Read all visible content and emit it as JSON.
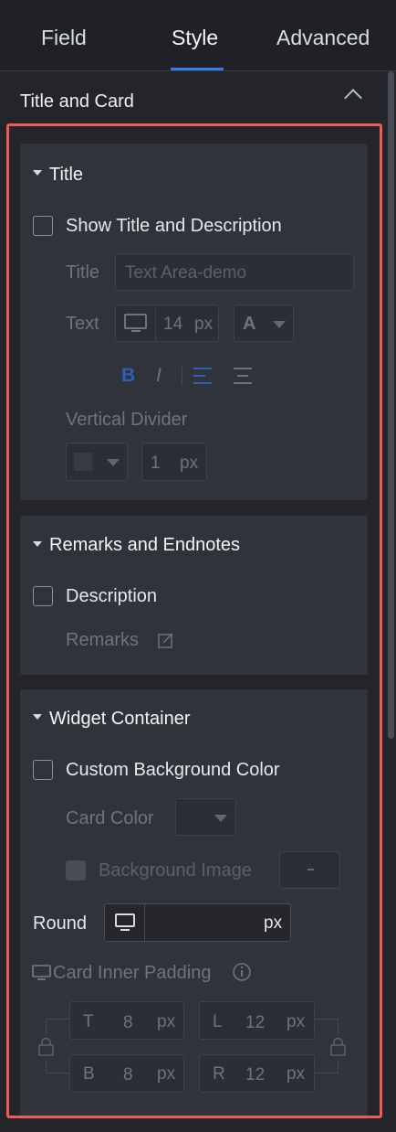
{
  "tabs": [
    {
      "label": "Field"
    },
    {
      "label": "Style"
    },
    {
      "label": "Advanced"
    }
  ],
  "section": {
    "title": "Title and Card"
  },
  "title_card": {
    "heading": "Title",
    "show_title_label": "Show Title and Description",
    "show_title_checked": false,
    "title_label": "Title",
    "title_placeholder": "Text Area-demo",
    "text_label": "Text",
    "font_size": "14",
    "font_unit": "px",
    "font_color_glyph": "A",
    "bold_glyph": "B",
    "italic_glyph": "I",
    "vertical_divider_label": "Vertical Divider",
    "divider_width": "1",
    "divider_unit": "px"
  },
  "remarks_card": {
    "heading": "Remarks and Endnotes",
    "description_label": "Description",
    "description_checked": false,
    "remarks_label": "Remarks"
  },
  "widget_card": {
    "heading": "Widget Container",
    "custom_bg_label": "Custom Background Color",
    "custom_bg_checked": false,
    "card_color_label": "Card Color",
    "bg_image_label": "Background Image",
    "round_label": "Round",
    "round_value": "",
    "round_unit": "px",
    "padding_label": "Card Inner Padding",
    "padding": {
      "top": {
        "letter": "T",
        "value": "8",
        "unit": "px"
      },
      "left": {
        "letter": "L",
        "value": "12",
        "unit": "px"
      },
      "bottom": {
        "letter": "B",
        "value": "8",
        "unit": "px"
      },
      "right": {
        "letter": "R",
        "value": "12",
        "unit": "px"
      }
    }
  },
  "colors": {
    "accent": "#3a7bf0",
    "highlight_border": "#f05a55",
    "panel_bg": "#23252b",
    "card_bg": "#30333a"
  }
}
